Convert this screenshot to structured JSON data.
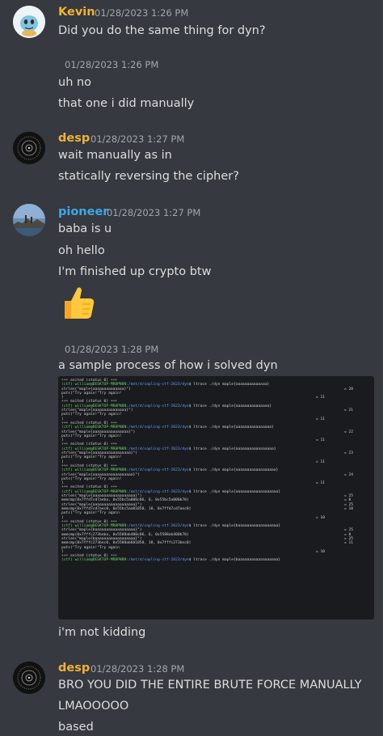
{
  "colors": {
    "kevin": "#f0b232",
    "desp": "#f0b232",
    "pioneer": "#3ea8e6",
    "background": "#36393f",
    "timestamp": "#a3a6aa"
  },
  "messages": {
    "kevin": {
      "author": "Kevin",
      "time": "01/28/2023 1:26 PM",
      "text": "Did you do the same thing for dyn?"
    },
    "reply1": {
      "time": "01/28/2023 1:26 PM",
      "line1": "uh no",
      "line2": "that one i did manually"
    },
    "desp1": {
      "author": "desp",
      "time": "01/28/2023 1:27 PM",
      "line1": "wait manually as in",
      "line2": "statically reversing the cipher?"
    },
    "pioneer": {
      "author": "pioneer",
      "time": "01/28/2023 1:27 PM",
      "line1": "baba is u",
      "line2": "oh hello",
      "line3": "I'm finished up crypto btw",
      "emoji_name": "thumbs-up-emoji"
    },
    "reply2": {
      "time": "01/28/2023 1:28 PM",
      "line1": "a sample process of how i solved dyn",
      "line2": "i'm not kidding"
    },
    "desp2": {
      "author": "desp",
      "time": "01/28/2023 1:28 PM",
      "line1": "BRO YOU DID THE ENTIRE BRUTE FORCE MANUALLY",
      "line2": "LMAOOOOO",
      "line3": "based"
    }
  },
  "terminal": {
    "lines": [
      {
        "t": "+++ exited (status 0) +++"
      },
      {
        "prompt": true,
        "cmd": "ltrace ./dyn maple{aaaaaaaaaaaaaa}"
      },
      {
        "t": "strlen(\"maple{aaaaaaaaaaaaaa}\")",
        "r": "= 20"
      },
      {
        "t": "puts(\"Try again!\"Try again!"
      },
      {
        "t": ")",
        "r": "= 11"
      },
      {
        "t": "+++ exited (status 0) +++"
      },
      {
        "prompt": true,
        "cmd": "ltrace ./dyn maple{aaaaaaaaaaaaaaa}"
      },
      {
        "t": "strlen(\"maple{aaaaaaaaaaaaaaa}\")",
        "r": "= 21"
      },
      {
        "t": "puts(\"Try again!\"Try again!"
      },
      {
        "t": ")",
        "r": "= 11"
      },
      {
        "t": "+++ exited (status 0) +++"
      },
      {
        "prompt": true,
        "cmd": "ltrace ./dyn maple{aaaaaaaaaaaaaaaa}"
      },
      {
        "t": "strlen(\"maple{aaaaaaaaaaaaaaaa}\")",
        "r": "= 22"
      },
      {
        "t": "puts(\"Try again!\"Try again!"
      },
      {
        "t": ")",
        "r": "= 11"
      },
      {
        "t": "+++ exited (status 0) +++"
      },
      {
        "prompt": true,
        "cmd": "ltrace ./dyn maple{aaaaaaaaaaaaaaaaa}"
      },
      {
        "t": "strlen(\"maple{aaaaaaaaaaaaaaaaa}\")",
        "r": "= 23"
      },
      {
        "t": "puts(\"Try again!\"Try again!"
      },
      {
        "t": ")",
        "r": "= 11"
      },
      {
        "t": "+++ exited (status 0) +++"
      },
      {
        "prompt": true,
        "cmd": "ltrace ./dyn maple{aaaaaaaaaaaaaaaaaa}"
      },
      {
        "t": "strlen(\"maple{aaaaaaaaaaaaaaaaaa}\")",
        "r": "= 24"
      },
      {
        "t": "puts(\"Try again!\"Try again!"
      },
      {
        "t": ")",
        "r": "= 11"
      },
      {
        "t": "+++ exited (status 0) +++"
      },
      {
        "prompt": true,
        "cmd": "ltrace ./dyn maple{aaaaaaaaaaaaaaaaaaa}"
      },
      {
        "t": "strlen(\"maple{aaaaaaaaaaaaaaaaaaa}\")",
        "r": "= 25"
      },
      {
        "t": "memcmp(0x7ffd7cd7aeba, 0x55bc5a000c06, 6, 0x55bc5a000b70)",
        "r": "= 0"
      },
      {
        "t": "strlen(\"maple{aaaaaaaaaaaaaaaaaaa}\")",
        "r": "= 25"
      },
      {
        "t": "memcmp(0x7ffd7cd7aec0, 0x55bc5aa01050, 18, 0x7ffd7cd7aec0)",
        "r": "= 10"
      },
      {
        "t": "puts(\"Try again!\"Try again"
      },
      {
        "t": ")",
        "r": "= 10"
      },
      {
        "t": "+++ exited (status 0) +++"
      },
      {
        "prompt": true,
        "cmd": "ltrace ./dyn maple{baaaaaaaaaaaaaaaaaa}"
      },
      {
        "t": "strlen(\"maple{baaaaaaaaaaaaaaaaaa}\")",
        "r": "= 25"
      },
      {
        "t": "memcmp(0x7fffc273beba, 0x5588ab400c06, 6, 0x5588ab400b70)",
        "r": "= 0"
      },
      {
        "t": "strlen(\"maple{baaaaaaaaaaaaaaaaaa}\")",
        "r": "= 25"
      },
      {
        "t": "memcmp(0x7fffc273bec0, 0x5588ab601050, 18, 0x7fffc273bec0)",
        "r": "= 11"
      },
      {
        "t": "puts(\"Try again!\"Try again"
      },
      {
        "t": ")",
        "r": "= 10"
      },
      {
        "t": "+++ exited (status 0) +++"
      },
      {
        "prompt": true,
        "cmd": "ltrace ./dyn maple{baaaaaaaaaaaaaaaaaa}"
      }
    ],
    "user": "(ctf) william@DESKTOP-MR8PN8N",
    "path": ":/mnt/d/sapling-ctf-2023/dyn",
    "dollar": "$ "
  }
}
